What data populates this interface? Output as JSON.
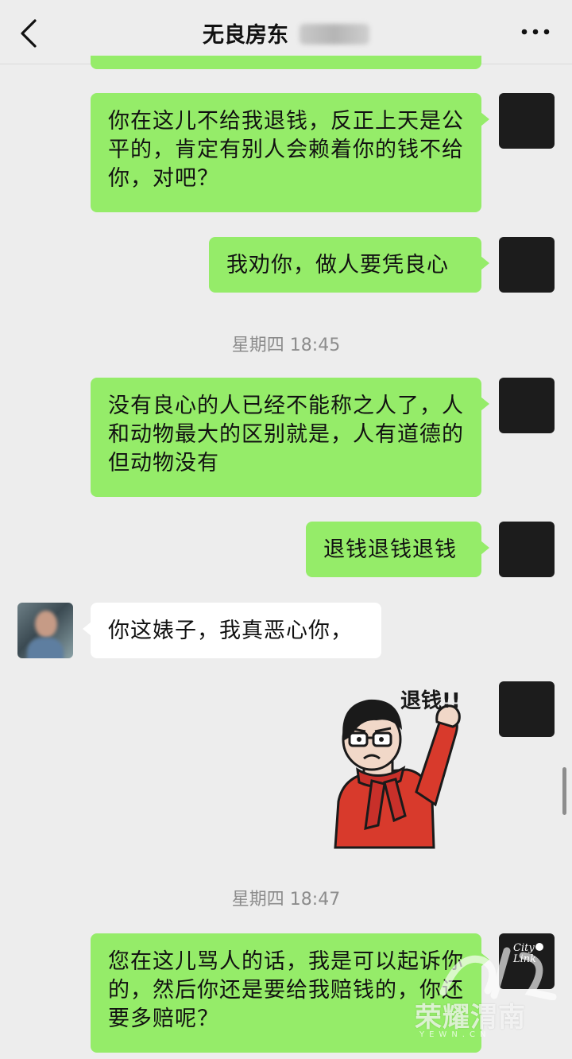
{
  "header": {
    "title": "无良房东",
    "back_icon": "chevron-left-icon",
    "more_icon": "ellipsis-icon"
  },
  "messages": [
    {
      "sender": "self",
      "text": "你在这儿不给我退钱，反正上天是公平的，肯定有别人会赖着你的钱不给你，对吧？"
    },
    {
      "sender": "self",
      "text": "我劝你，做人要凭良心"
    },
    {
      "type": "time",
      "text": "星期四 18:45"
    },
    {
      "sender": "self",
      "text": "没有良心的人已经不能称之人了，人和动物最大的区别就是，人有道德的但动物没有"
    },
    {
      "sender": "self",
      "text": "退钱退钱退钱"
    },
    {
      "sender": "other",
      "text": "你这婊子，我真恶心你，"
    },
    {
      "sender": "self",
      "type": "sticker",
      "caption": "退钱!!"
    },
    {
      "type": "time",
      "text": "星期四 18:47"
    },
    {
      "sender": "self",
      "text": "您在这儿骂人的话，我是可以起诉你的，然后你还是要给我赔钱的，你还要多赔呢？"
    }
  ],
  "avatars": {
    "citylink_line1": "City",
    "citylink_line2": "Link"
  },
  "watermark": {
    "main": "荣耀渭南",
    "sub": "YEWN.CN"
  },
  "colors": {
    "background": "#ededed",
    "self_bubble": "#95ec69",
    "other_bubble": "#ffffff",
    "sticker_sweater": "#d83a2c"
  }
}
